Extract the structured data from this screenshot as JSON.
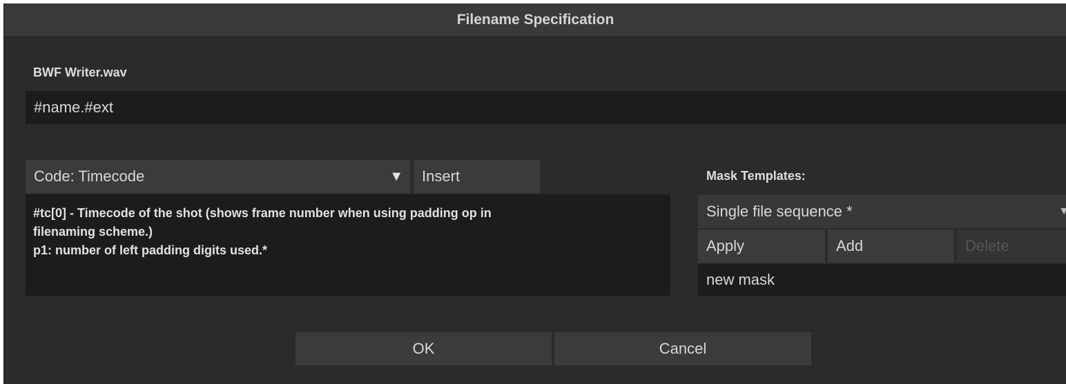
{
  "window": {
    "title": "Filename Specification"
  },
  "writer": {
    "label": "BWF Writer.wav",
    "filename_value": "#name.#ext"
  },
  "code": {
    "selected": "Code: Timecode",
    "insert_label": "Insert",
    "description_lines": [
      "#tc[0] - Timecode of the shot (shows frame number when using padding op in",
      "filenaming scheme.)",
      " p1: number of left padding digits used.*"
    ]
  },
  "mask_templates": {
    "label": "Mask Templates:",
    "selected": "Single file sequence *",
    "apply_label": "Apply",
    "add_label": "Add",
    "delete_label": "Delete",
    "new_mask_value": "new mask"
  },
  "footer": {
    "ok_label": "OK",
    "cancel_label": "Cancel"
  },
  "icons": {
    "dropdown_arrow": "▼"
  },
  "colors": {
    "window_bg": "#2b2b2b",
    "titlebar_bg": "#3a3a3a",
    "field_bg": "#1c1c1c",
    "button_bg": "#3b3b3b",
    "text": "#d8d8d8",
    "disabled_text": "#555555"
  }
}
